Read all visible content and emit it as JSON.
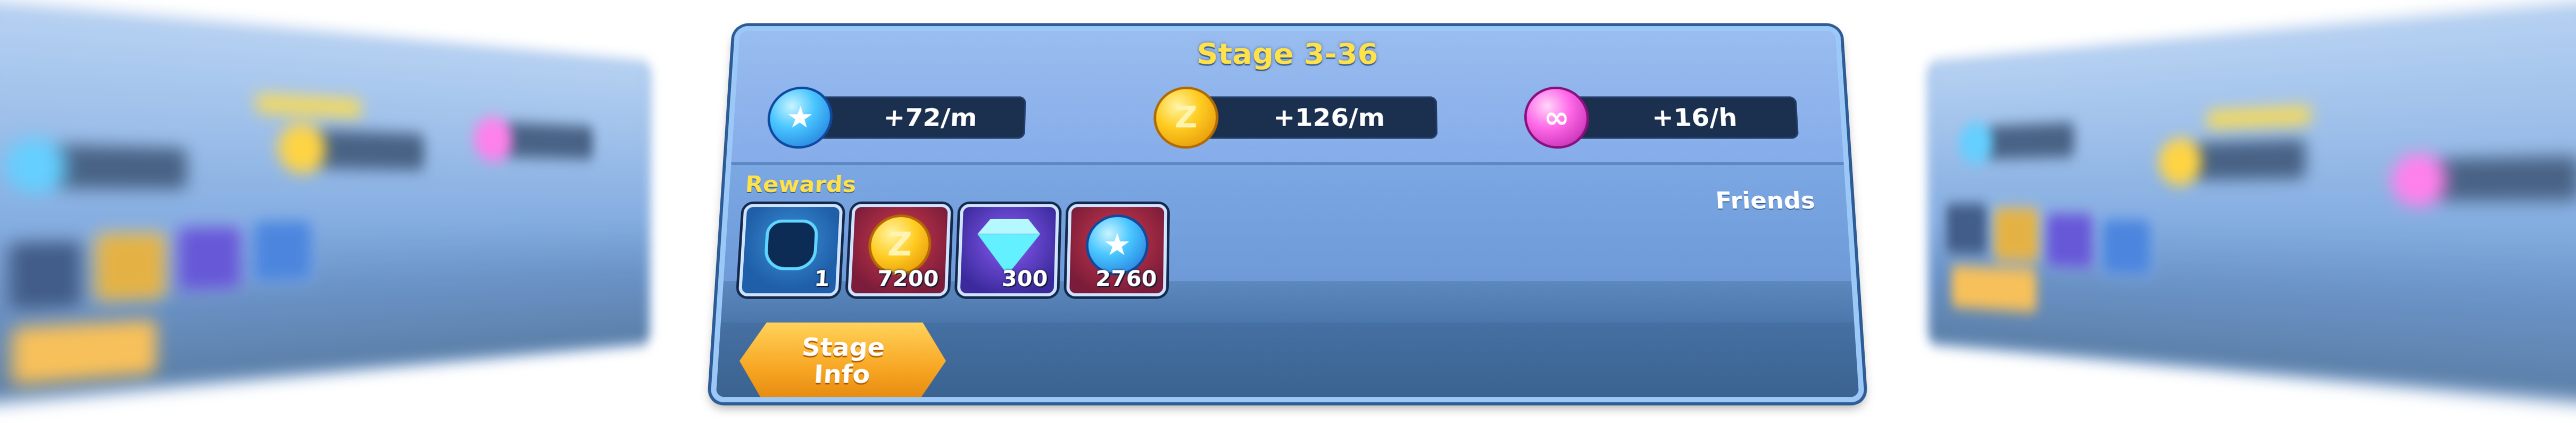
{
  "stage": {
    "title": "Stage 3-36"
  },
  "rates": [
    {
      "icon": "blue-star-orb-icon",
      "value": "+72/m",
      "color": "#49c6ff"
    },
    {
      "icon": "gold-z-coin-icon",
      "value": "+126/m",
      "color": "#ffcc22"
    },
    {
      "icon": "pink-dna-orb-icon",
      "value": "+16/h",
      "color": "#ff6ae8"
    }
  ],
  "rewards": {
    "label": "Rewards",
    "items": [
      {
        "icon": "armor-icon",
        "qty": "1"
      },
      {
        "icon": "z-coin-icon",
        "glyph": "Z",
        "qty": "7200"
      },
      {
        "icon": "diamond-gem-icon",
        "qty": "300"
      },
      {
        "icon": "blue-star-orb-icon",
        "glyph": "★",
        "qty": "2760"
      }
    ]
  },
  "friends": {
    "label": "Friends"
  },
  "stage_info_button": {
    "line1": "Stage",
    "line2": "Info"
  },
  "coin_glyph": "Z",
  "star_glyph": "★",
  "dna_glyph": "∞"
}
